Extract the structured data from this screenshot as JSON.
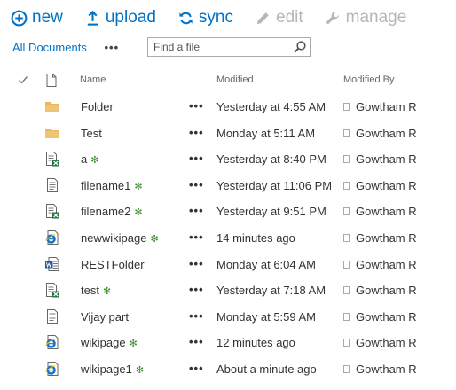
{
  "toolbar": {
    "new_label": "new",
    "upload_label": "upload",
    "sync_label": "sync",
    "edit_label": "edit",
    "manage_label": "manage"
  },
  "view": {
    "current": "All Documents",
    "menu_glyph": "•••"
  },
  "search": {
    "placeholder": "Find a file",
    "value": ""
  },
  "columns": {
    "name": "Name",
    "modified": "Modified",
    "modified_by": "Modified By"
  },
  "colors": {
    "accent": "#0072c6",
    "disabled": "#b6b6b6",
    "new_marker": "#3f8d2f",
    "folder": "#e8b85a"
  },
  "files": [
    {
      "name": "Folder",
      "type_icon": "folder-icon",
      "new_marker": "",
      "modified": "Yesterday at 4:55 AM",
      "modified_by": "Gowtham R"
    },
    {
      "name": "Test",
      "type_icon": "folder-icon",
      "new_marker": "",
      "modified": "Monday at 5:11 AM",
      "modified_by": "Gowtham R"
    },
    {
      "name": "a",
      "type_icon": "excel-document-icon",
      "new_marker": "✻",
      "modified": "Yesterday at 8:40 PM",
      "modified_by": "Gowtham R"
    },
    {
      "name": "filename1",
      "type_icon": "text-document-icon",
      "new_marker": "✻",
      "modified": "Yesterday at 11:06 PM",
      "modified_by": "Gowtham R"
    },
    {
      "name": "filename2",
      "type_icon": "excel-document-icon",
      "new_marker": "✻",
      "modified": "Yesterday at 9:51 PM",
      "modified_by": "Gowtham R"
    },
    {
      "name": "newwikipage",
      "type_icon": "web-page-icon",
      "new_marker": "✻",
      "modified": "14 minutes ago",
      "modified_by": "Gowtham R"
    },
    {
      "name": "RESTFolder",
      "type_icon": "word-document-icon",
      "new_marker": "",
      "modified": "Monday at 6:04 AM",
      "modified_by": "Gowtham R"
    },
    {
      "name": "test",
      "type_icon": "excel-document-icon",
      "new_marker": "✻",
      "modified": "Yesterday at 7:18 AM",
      "modified_by": "Gowtham R"
    },
    {
      "name": "Vijay part",
      "type_icon": "text-document-icon",
      "new_marker": "",
      "modified": "Monday at 5:59 AM",
      "modified_by": "Gowtham R"
    },
    {
      "name": "wikipage",
      "type_icon": "web-page-icon",
      "new_marker": "✻",
      "modified": "12 minutes ago",
      "modified_by": "Gowtham R"
    },
    {
      "name": "wikipage1",
      "type_icon": "web-page-icon",
      "new_marker": "✻",
      "modified": "About a minute ago",
      "modified_by": "Gowtham R"
    }
  ]
}
